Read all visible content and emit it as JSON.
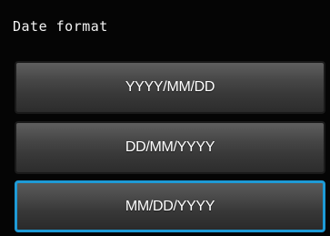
{
  "screen": {
    "title": "Date format"
  },
  "options": [
    {
      "label": "YYYY/MM/DD",
      "selected": false
    },
    {
      "label": "DD/MM/YYYY",
      "selected": false
    },
    {
      "label": "MM/DD/YYYY",
      "selected": true
    }
  ],
  "colors": {
    "background": "#050505",
    "button": "#474747",
    "selection_border": "#1e9ad6",
    "text": "#ffffff"
  }
}
